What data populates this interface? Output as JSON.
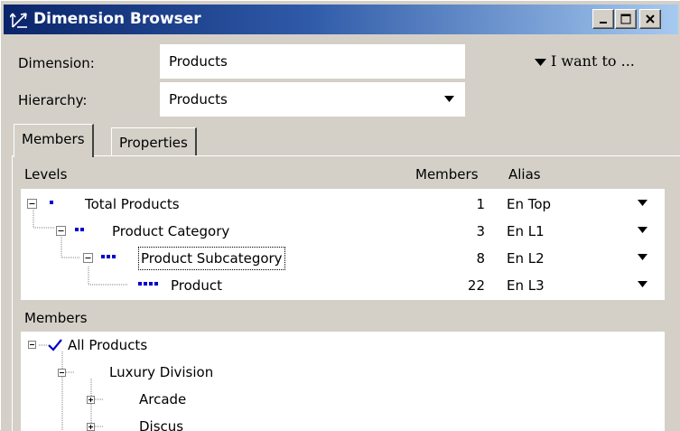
{
  "window": {
    "title": "Dimension Browser",
    "icon": "hierarchy-arrows-icon"
  },
  "form": {
    "dimension_label": "Dimension:",
    "dimension_value": "Products",
    "hierarchy_label": "Hierarchy:",
    "hierarchy_value": "Products",
    "i_want_to": "I want to ..."
  },
  "tabs": [
    {
      "label": "Members",
      "active": true
    },
    {
      "label": "Properties",
      "active": false
    }
  ],
  "levels": {
    "header_levels": "Levels",
    "header_members": "Members",
    "header_alias": "Alias",
    "rows": [
      {
        "name": "Total Products",
        "members": "1",
        "alias": "En Top"
      },
      {
        "name": "Product Category",
        "members": "3",
        "alias": "En L1"
      },
      {
        "name": "Product Subcategory",
        "members": "8",
        "alias": "En L2"
      },
      {
        "name": "Product",
        "members": "22",
        "alias": "En L3"
      }
    ]
  },
  "members": {
    "header": "Members",
    "tree": [
      {
        "label": "All Products",
        "checked": true
      },
      {
        "label": "Luxury Division"
      },
      {
        "label": "Arcade"
      },
      {
        "label": "Discus"
      }
    ]
  },
  "colors": {
    "accent": "#0000cc",
    "title_start": "#0a246a",
    "title_end": "#a6caf0",
    "face": "#d4d0c8"
  }
}
